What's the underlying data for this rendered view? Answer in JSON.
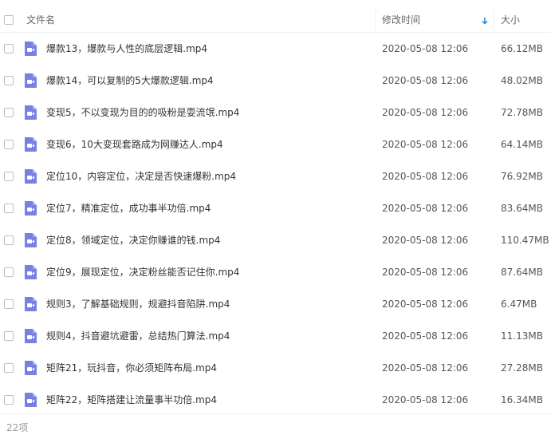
{
  "header": {
    "name_label": "文件名",
    "modified_label": "修改时间",
    "size_label": "大小",
    "sort_icon": "arrow-down-icon",
    "sort_color": "#1e88e5"
  },
  "file_icon": {
    "name": "video-file-icon",
    "color": "#7b7fe0"
  },
  "rows": [
    {
      "name": "爆款13，爆款与人性的底层逻辑.mp4",
      "date": "2020-05-08 12:06",
      "size": "66.12MB"
    },
    {
      "name": "爆款14，可以复制的5大爆款逻辑.mp4",
      "date": "2020-05-08 12:06",
      "size": "48.02MB"
    },
    {
      "name": "变现5，不以变现为目的的吸粉是耍流氓.mp4",
      "date": "2020-05-08 12:06",
      "size": "72.78MB"
    },
    {
      "name": "变现6，10大变现套路成为网赚达人.mp4",
      "date": "2020-05-08 12:06",
      "size": "64.14MB"
    },
    {
      "name": "定位10，内容定位，决定是否快速爆粉.mp4",
      "date": "2020-05-08 12:06",
      "size": "76.92MB"
    },
    {
      "name": "定位7，精准定位，成功事半功倍.mp4",
      "date": "2020-05-08 12:06",
      "size": "83.64MB"
    },
    {
      "name": "定位8，领域定位，决定你赚谁的钱.mp4",
      "date": "2020-05-08 12:06",
      "size": "110.47MB"
    },
    {
      "name": "定位9，展现定位，决定粉丝能否记住你.mp4",
      "date": "2020-05-08 12:06",
      "size": "87.64MB"
    },
    {
      "name": "规则3，了解基础规则，规避抖音陷阱.mp4",
      "date": "2020-05-08 12:06",
      "size": "6.47MB"
    },
    {
      "name": "规则4，抖音避坑避雷，总结热门算法.mp4",
      "date": "2020-05-08 12:06",
      "size": "11.13MB"
    },
    {
      "name": "矩阵21，玩抖音，你必须矩阵布局.mp4",
      "date": "2020-05-08 12:06",
      "size": "27.28MB"
    },
    {
      "name": "矩阵22，矩阵搭建让流量事半功倍.mp4",
      "date": "2020-05-08 12:06",
      "size": "16.34MB"
    }
  ],
  "footer": {
    "count": "22项"
  }
}
